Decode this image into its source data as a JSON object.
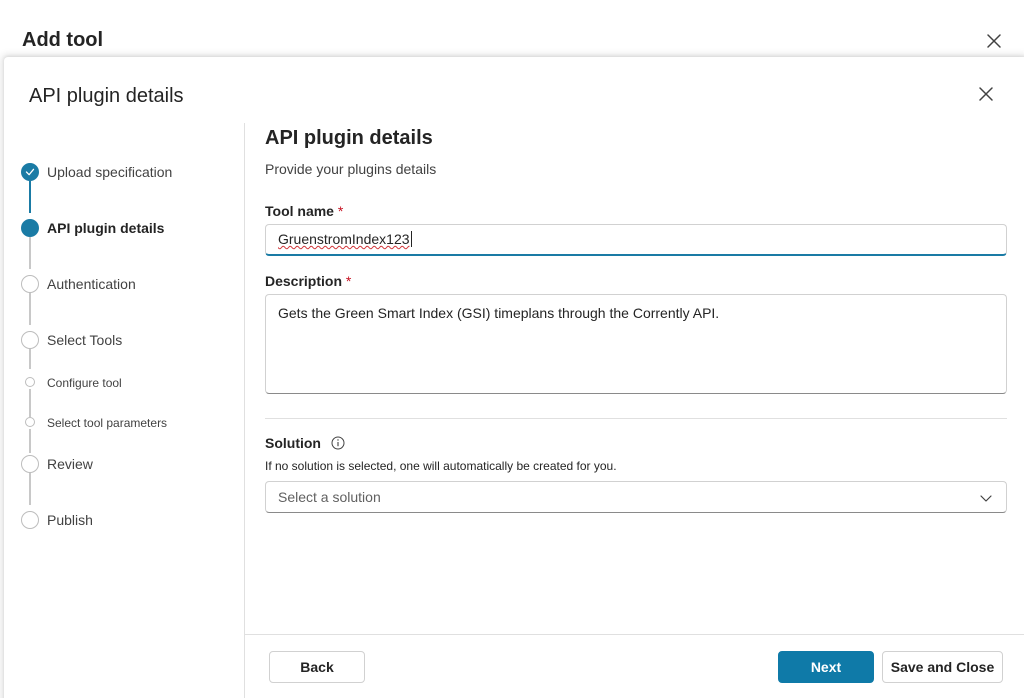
{
  "outer": {
    "title": "Add tool"
  },
  "dialog": {
    "title": "API plugin details"
  },
  "stepper": {
    "steps": [
      {
        "label": "Upload specification",
        "state": "done"
      },
      {
        "label": "API plugin details",
        "state": "current"
      },
      {
        "label": "Authentication",
        "state": "pending"
      },
      {
        "label": "Select Tools",
        "state": "pending"
      },
      {
        "label": "Configure tool",
        "state": "pending-sub"
      },
      {
        "label": "Select tool parameters",
        "state": "pending-sub"
      },
      {
        "label": "Review",
        "state": "pending"
      },
      {
        "label": "Publish",
        "state": "pending"
      }
    ]
  },
  "form": {
    "heading": "API plugin details",
    "subheading": "Provide your plugins details",
    "tool_name": {
      "label": "Tool name",
      "required_mark": "*",
      "value": "GruenstromIndex123"
    },
    "description": {
      "label": "Description",
      "required_mark": "*",
      "value": "Gets the Green Smart Index (GSI) timeplans through the Corrently API."
    },
    "solution": {
      "label": "Solution",
      "helper": "If no solution is selected, one will automatically be created for you.",
      "placeholder": "Select a solution"
    }
  },
  "footer": {
    "back_label": "Back",
    "next_label": "Next",
    "save_close_label": "Save and Close"
  },
  "colors": {
    "accent": "#1a7ba5",
    "primary_button": "#0f7aa8",
    "required": "#c50f1f"
  }
}
